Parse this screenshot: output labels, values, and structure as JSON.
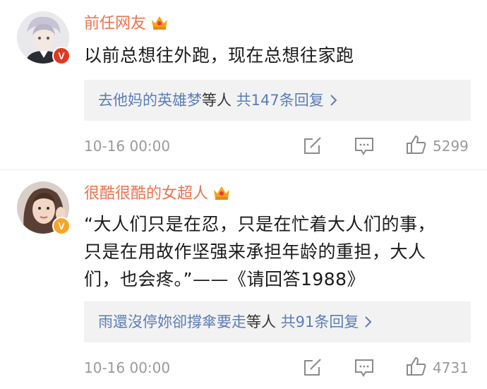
{
  "comments": [
    {
      "username": "前任网友",
      "text": "以前总想往外跑，现在总想往家跑",
      "reply_name": "去他妈的英雄梦",
      "reply_mid": "等人",
      "reply_count": "共147条回复",
      "time": "10-16 00:00",
      "likes": "5299",
      "badge_letter": "V",
      "badge_color": "#e03a1e"
    },
    {
      "username": "很酷很酷的女超人",
      "text": "“大人们只是在忍，只是在忙着大人们的事，只是在用故作坚强来承担年龄的重担，大人们，也会疼。”——《请回答1988》",
      "reply_name": "雨還沒停妳卻撐傘要走",
      "reply_mid": "等人",
      "reply_count": "共91条回复",
      "time": "10-16 00:00",
      "likes": "4731",
      "badge_letter": "V",
      "badge_color": "#f5a623"
    }
  ],
  "colors": {
    "username": "#eb7350",
    "link": "#5b7db7",
    "meta": "#9a9a9a",
    "reply_bg": "#f2f2f2"
  },
  "icons": {
    "crown": "crown-icon",
    "edit": "share-edit-icon",
    "comment": "comment-icon",
    "like": "thumbs-up-icon",
    "chevron": "chevron-right-icon"
  }
}
